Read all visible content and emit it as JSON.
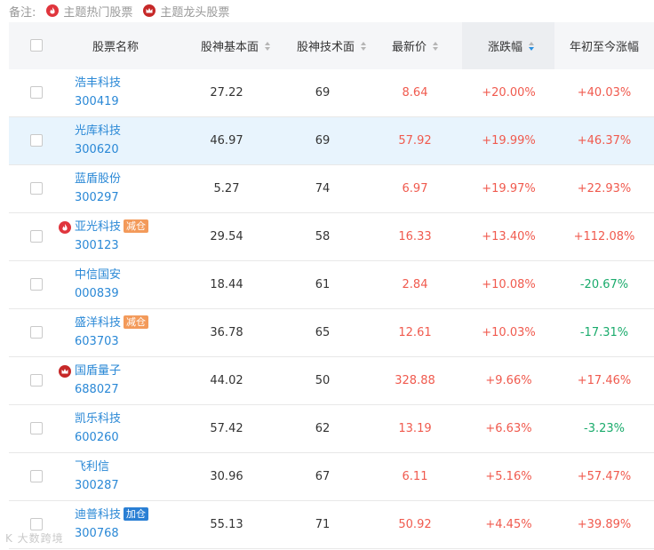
{
  "note": {
    "label": "备注:",
    "hot_label": "主题热门股票",
    "leader_label": "主题龙头股票"
  },
  "columns": [
    "股票名称",
    "股神基本面",
    "股神技术面",
    "最新价",
    "涨跌幅",
    "年初至今涨幅"
  ],
  "rows": [
    {
      "name": "浩丰科技",
      "code": "300419",
      "tag": "",
      "icon": "",
      "fund": "27.22",
      "tech": "69",
      "price": "8.64",
      "change": "+20.00%",
      "ytd": "+40.03%",
      "ytd_dir": "up"
    },
    {
      "name": "光库科技",
      "code": "300620",
      "tag": "",
      "icon": "",
      "fund": "46.97",
      "tech": "69",
      "price": "57.92",
      "change": "+19.99%",
      "ytd": "+46.37%",
      "ytd_dir": "up",
      "highlight": true
    },
    {
      "name": "蓝盾股份",
      "code": "300297",
      "tag": "",
      "icon": "",
      "fund": "5.27",
      "tech": "74",
      "price": "6.97",
      "change": "+19.97%",
      "ytd": "+22.93%",
      "ytd_dir": "up"
    },
    {
      "name": "亚光科技",
      "code": "300123",
      "tag": "减仓",
      "tag_type": "cut",
      "icon": "hot",
      "fund": "29.54",
      "tech": "58",
      "price": "16.33",
      "change": "+13.40%",
      "ytd": "+112.08%",
      "ytd_dir": "up"
    },
    {
      "name": "中信国安",
      "code": "000839",
      "tag": "",
      "icon": "",
      "fund": "18.44",
      "tech": "61",
      "price": "2.84",
      "change": "+10.08%",
      "ytd": "-20.67%",
      "ytd_dir": "down"
    },
    {
      "name": "盛洋科技",
      "code": "603703",
      "tag": "减仓",
      "tag_type": "cut",
      "icon": "",
      "fund": "36.78",
      "tech": "65",
      "price": "12.61",
      "change": "+10.03%",
      "ytd": "-17.31%",
      "ytd_dir": "down"
    },
    {
      "name": "国盾量子",
      "code": "688027",
      "tag": "",
      "icon": "leader",
      "fund": "44.02",
      "tech": "50",
      "price": "328.88",
      "change": "+9.66%",
      "ytd": "+17.46%",
      "ytd_dir": "up"
    },
    {
      "name": "凯乐科技",
      "code": "600260",
      "tag": "",
      "icon": "",
      "fund": "57.42",
      "tech": "62",
      "price": "13.19",
      "change": "+6.63%",
      "ytd": "-3.23%",
      "ytd_dir": "down"
    },
    {
      "name": "飞利信",
      "code": "300287",
      "tag": "",
      "icon": "",
      "fund": "30.96",
      "tech": "67",
      "price": "6.11",
      "change": "+5.16%",
      "ytd": "+57.47%",
      "ytd_dir": "up"
    },
    {
      "name": "迪普科技",
      "code": "300768",
      "tag": "加仓",
      "tag_type": "add",
      "icon": "",
      "fund": "55.13",
      "tech": "71",
      "price": "50.92",
      "change": "+4.45%",
      "ytd": "+39.89%",
      "ytd_dir": "up"
    }
  ],
  "watermark": "K 大数跨境",
  "colors": {
    "up": "#f05a4e",
    "down": "#1aab6c",
    "link": "#2a88d6",
    "sort_active": "#2a90e0"
  }
}
